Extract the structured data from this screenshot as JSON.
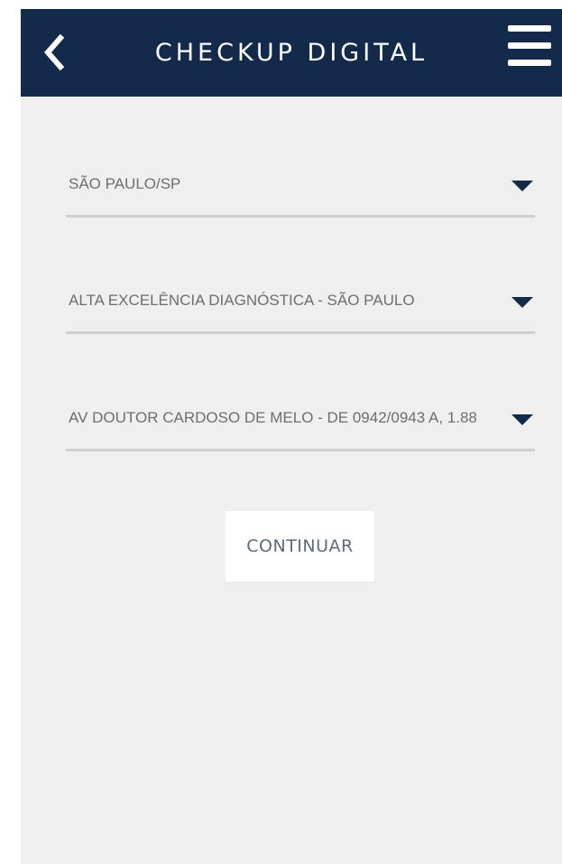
{
  "header": {
    "title": "CHECKUP DIGITAL",
    "back_icon": "chevron-left-icon",
    "menu_icon": "hamburger-menu-icon",
    "background_color": "#142a4b"
  },
  "form": {
    "city_select": {
      "value": "SÃO PAULO/SP",
      "icon": "caret-down-icon"
    },
    "lab_select": {
      "value": "ALTA EXCELÊNCIA DIAGNÓSTICA - SÃO PAULO",
      "icon": "caret-down-icon"
    },
    "address_select": {
      "value": "AV DOUTOR CARDOSO DE MELO - DE 0942/0943 A, 1.88",
      "icon": "caret-down-icon"
    },
    "continue_label": "CONTINUAR"
  },
  "colors": {
    "background": "#efefef",
    "field_text": "#6e6e6e",
    "underline": "#cfcfcf",
    "caret": "#142a4b"
  }
}
